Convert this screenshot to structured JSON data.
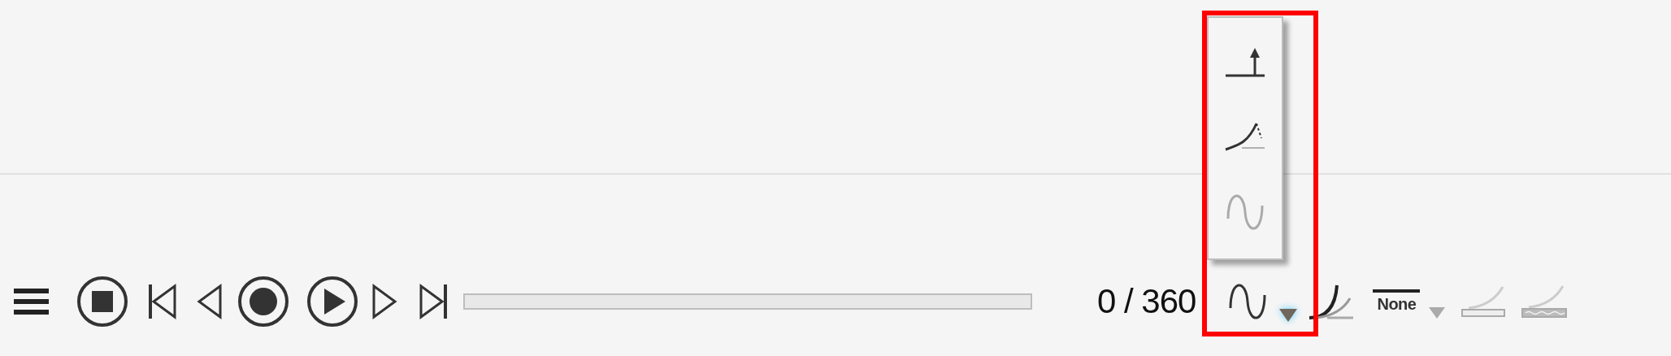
{
  "player": {
    "progress": {
      "level": 0
    },
    "counter": "0 / 360"
  },
  "wave_dropdown": {
    "expanded": true,
    "options": [
      {
        "kind": "step",
        "disabled": false
      },
      {
        "kind": "exponential",
        "disabled": false
      },
      {
        "kind": "sine",
        "disabled": true
      }
    ]
  },
  "curve_tools": {
    "none_label": "None"
  }
}
